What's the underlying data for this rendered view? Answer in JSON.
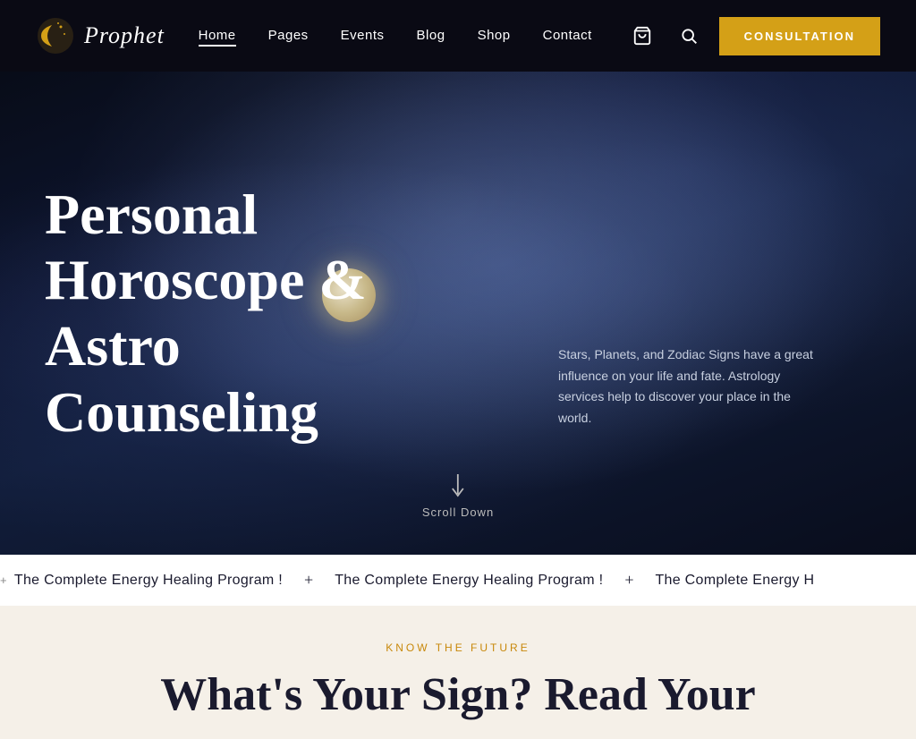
{
  "site": {
    "name": "Prophet"
  },
  "navbar": {
    "links": [
      {
        "label": "Home",
        "active": true
      },
      {
        "label": "Pages",
        "active": false
      },
      {
        "label": "Events",
        "active": false
      },
      {
        "label": "Blog",
        "active": false
      },
      {
        "label": "Shop",
        "active": false
      },
      {
        "label": "Contact",
        "active": false
      }
    ],
    "consultation_label": "CONSULTATION"
  },
  "hero": {
    "title": "Personal Horoscope & Astro Counseling",
    "subtitle": "Stars, Planets, and Zodiac Signs have a great influence on your life and fate. Astrology services help to discover your place in the world.",
    "scroll_label": "Scroll Down"
  },
  "ticker": {
    "items": [
      "The Complete Energy Healing Program !",
      "The Complete Energy Healing Program !",
      "The Complete Energy H"
    ]
  },
  "below": {
    "label": "KNOW THE FUTURE",
    "title": "What's Your Sign? Read Your"
  }
}
